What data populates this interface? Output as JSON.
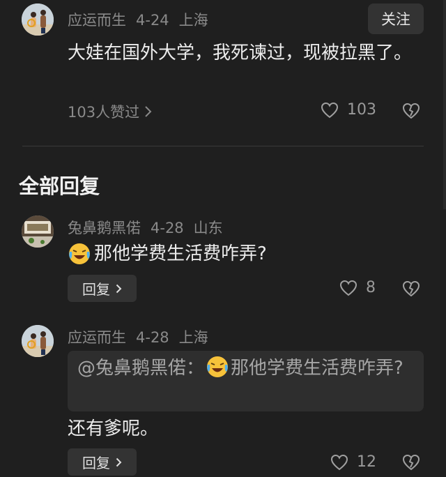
{
  "main_comment": {
    "username": "应运而生",
    "date": "4-24",
    "location": "上海",
    "follow_label": "关注",
    "text": "大娃在国外大学，我死谏过，现被拉黑了。",
    "liked_by": "103人赞过",
    "like_count": "103"
  },
  "section_title": "全部回复",
  "replies": [
    {
      "username": "兔鼻鹅黑偌",
      "date": "4-28",
      "location": "山东",
      "text": "那他学费生活费咋弄?",
      "emoji": "laughing-crying-emoji",
      "reply_label": "回复",
      "like_count": "8"
    },
    {
      "username": "应运而生",
      "date": "4-28",
      "location": "上海",
      "quote_prefix": "@兔鼻鹅黑偌：",
      "quote_text": "那他学费生活费咋弄?",
      "text": "还有爹呢。",
      "reply_label": "回复",
      "like_count": "12"
    }
  ],
  "colors": {
    "background": "#1f1f1f",
    "button_bg": "#333333",
    "meta_text": "#8a8a8a"
  }
}
